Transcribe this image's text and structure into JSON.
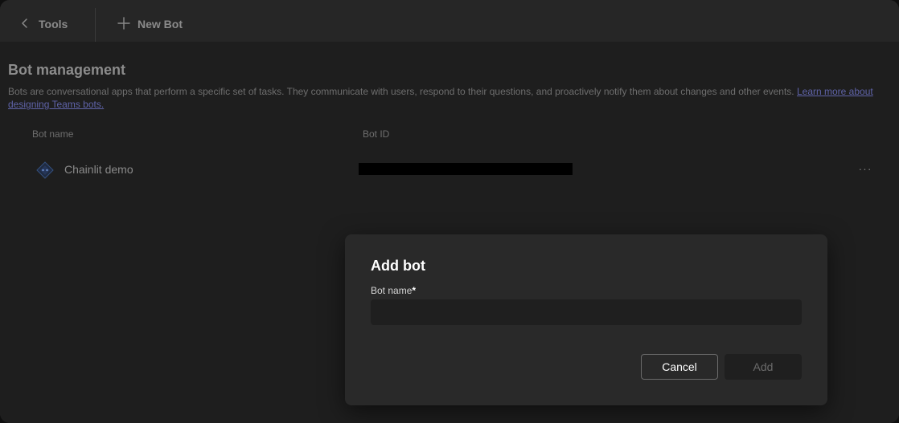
{
  "toolbar": {
    "back_label": "Tools",
    "back_icon": "chevron-left-icon",
    "new_bot_label": "New Bot",
    "new_bot_icon": "plus-icon"
  },
  "page": {
    "title": "Bot management",
    "description": "Bots are conversational apps that perform a specific set of tasks. They communicate with users, respond to their questions, and proactively notify them about changes and other events.",
    "learn_more_link": "Learn more about designing Teams bots."
  },
  "table": {
    "columns": [
      "Bot name",
      "Bot ID"
    ],
    "rows": [
      {
        "name": "Chainlit demo",
        "icon": "bot-icon",
        "bot_id": "",
        "more_label": "···"
      }
    ]
  },
  "dialog": {
    "title": "Add bot",
    "field_label": "Bot name",
    "required_marker": "*",
    "field_value": "",
    "field_placeholder": "",
    "cancel_label": "Cancel",
    "add_label": "Add"
  },
  "colors": {
    "background": "#1e1e1e",
    "dialog_background": "#292929",
    "link": "#5f63a8",
    "bot_icon_accent": "#3a5a9a"
  }
}
